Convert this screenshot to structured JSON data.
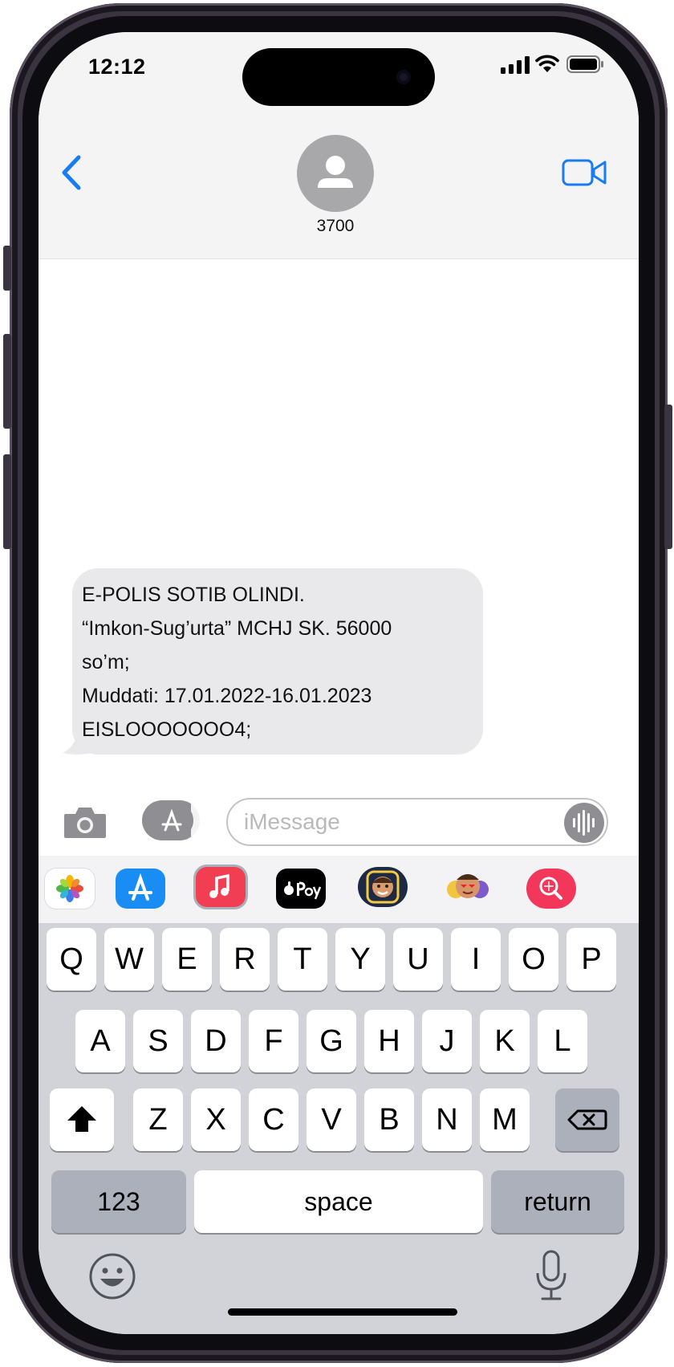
{
  "status_bar": {
    "time": "12:12"
  },
  "header": {
    "contact_name": "3700"
  },
  "message": {
    "lines": [
      "E-POLIS SOTIB OLINDI.",
      "“Imkon-Sug’urta” MCHJ SK. 56000",
      "so’m;",
      "Muddati: 17.01.2022-16.01.2023",
      "EISLOOOOOOO4;"
    ]
  },
  "compose": {
    "placeholder": "iMessage"
  },
  "app_strip": [
    "photos-icon",
    "app-store-icon",
    "music-icon",
    "apple-pay-icon",
    "memoji-icon",
    "animoji-icon",
    "image-search-icon"
  ],
  "keyboard": {
    "row1": [
      "Q",
      "W",
      "E",
      "R",
      "T",
      "Y",
      "U",
      "I",
      "O",
      "P"
    ],
    "row2": [
      "A",
      "S",
      "D",
      "F",
      "G",
      "H",
      "J",
      "K",
      "L"
    ],
    "row3": [
      "Z",
      "X",
      "C",
      "V",
      "B",
      "N",
      "M"
    ],
    "numbers_label": "123",
    "space_label": "space",
    "return_label": "return"
  },
  "colors": {
    "accent": "#1a7cf5",
    "bubble": "#e9e9eb",
    "keyboard_bg": "#d1d3d9"
  }
}
